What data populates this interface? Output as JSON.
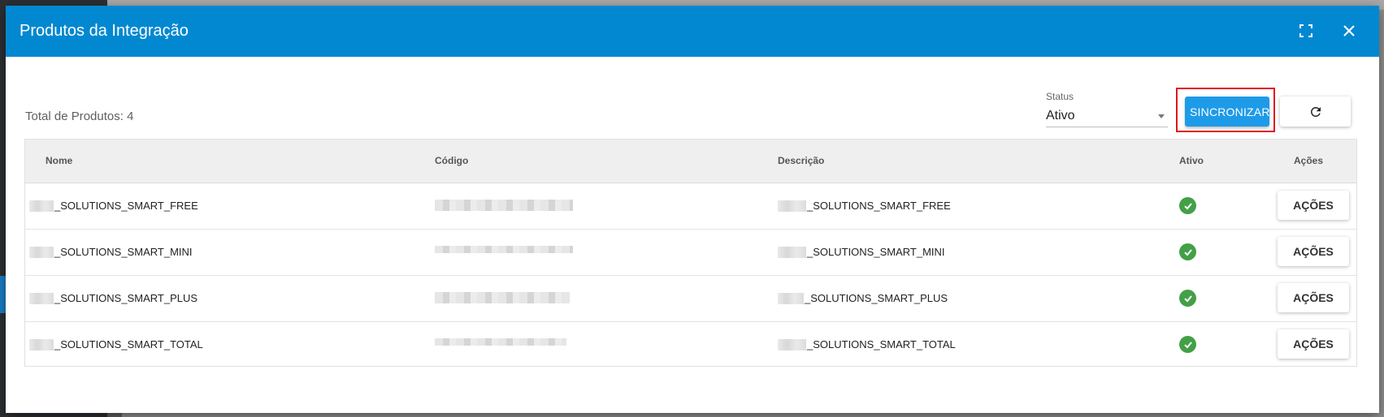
{
  "modal": {
    "title": "Produtos da Integração",
    "expand_icon": "fullscreen-icon",
    "close_icon": "close-icon",
    "accent_color": "#0288d1"
  },
  "toolbar": {
    "total_label": "Total de Produtos: 4",
    "status_caption": "Status",
    "status_value": "Ativo",
    "sync_label": "SINCRONIZAR",
    "refresh_icon": "refresh-icon"
  },
  "table": {
    "headers": [
      "Nome",
      "Código",
      "Descrição",
      "Ativo",
      "Ações"
    ],
    "rows": [
      {
        "name": "_SOLUTIONS_SMART_FREE",
        "description": "_SOLUTIONS_SMART_FREE",
        "active": true,
        "action_label": "AÇÕES"
      },
      {
        "name": "_SOLUTIONS_SMART_MINI",
        "description": "_SOLUTIONS_SMART_MINI",
        "active": true,
        "action_label": "AÇÕES"
      },
      {
        "name": "_SOLUTIONS_SMART_PLUS",
        "description": "_SOLUTIONS_SMART_PLUS",
        "active": true,
        "action_label": "AÇÕES"
      },
      {
        "name": "_SOLUTIONS_SMART_TOTAL",
        "description": "_SOLUTIONS_SMART_TOTAL",
        "active": true,
        "action_label": "AÇÕES"
      }
    ],
    "active_color": "#43a047"
  }
}
